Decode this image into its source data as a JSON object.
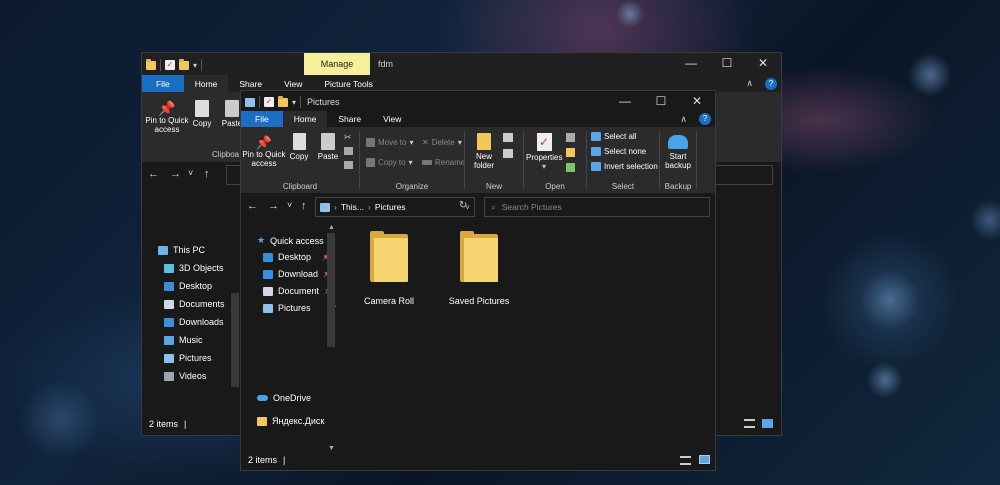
{
  "background": {
    "accent": "#1a6fc4",
    "folder_color": "#f6d46f"
  },
  "back_window": {
    "qat_dropdown": "▾",
    "manage_label": "Manage",
    "title": "fdm",
    "controls": {
      "minimize": "—",
      "maximize": "☐",
      "close": "✕"
    },
    "collapse": "∧",
    "help": "?",
    "tabs": {
      "file": "File",
      "home": "Home",
      "share": "Share",
      "view": "View",
      "picture_tools": "Picture Tools"
    },
    "ribbon": {
      "pin_label": "Pin to Quick access",
      "copy_label": "Copy",
      "paste_label": "Paste",
      "clipboard_group": "Clipboa"
    },
    "nav": {
      "back": "←",
      "forward": "→",
      "recent": "˅",
      "up": "↑"
    },
    "nav_items": [
      "This PC",
      "3D Objects",
      "Desktop",
      "Documents",
      "Downloads",
      "Music",
      "Pictures",
      "Videos"
    ],
    "status": {
      "items": "2 items",
      "sep": "|"
    }
  },
  "front_window": {
    "qat_dropdown": "▾",
    "title": "Pictures",
    "controls": {
      "minimize": "—",
      "maximize": "☐",
      "close": "✕"
    },
    "collapse": "∧",
    "help": "?",
    "tabs": {
      "file": "File",
      "home": "Home",
      "share": "Share",
      "view": "View"
    },
    "ribbon": {
      "clipboard": {
        "pin": "Pin to Quick access",
        "copy": "Copy",
        "paste": "Paste",
        "label": "Clipboard"
      },
      "organize": {
        "move_to": "Move to",
        "copy_to": "Copy to",
        "delete": "Delete",
        "rename": "Rename",
        "label": "Organize"
      },
      "new": {
        "new_folder": "New folder",
        "label": "New"
      },
      "open": {
        "properties": "Properties",
        "label": "Open"
      },
      "select": {
        "select_all": "Select all",
        "select_none": "Select none",
        "invert": "Invert selection",
        "label": "Select"
      },
      "backup": {
        "start_backup": "Start backup",
        "label": "Backup"
      }
    },
    "nav": {
      "back": "←",
      "forward": "→",
      "recent": "˅",
      "up": "↑"
    },
    "address": {
      "sep": "›",
      "crumb_1": "This...",
      "crumb_2": "Pictures",
      "dropdown": "˅",
      "refresh": "↻"
    },
    "search": {
      "placeholder": "Search Pictures"
    },
    "nav_items": {
      "quick_access": "Quick access",
      "desktop": "Desktop",
      "downloads": "Download",
      "documents": "Document",
      "pictures": "Pictures",
      "onedrive": "OneDrive",
      "yandex": "Яндекс.Диск"
    },
    "pin_glyph": "📌",
    "scroll": {
      "up": "▲",
      "down": "▼"
    },
    "folders": [
      {
        "name": "Camera Roll"
      },
      {
        "name": "Saved Pictures"
      }
    ],
    "status": {
      "items": "2 items",
      "sep": "|"
    }
  }
}
